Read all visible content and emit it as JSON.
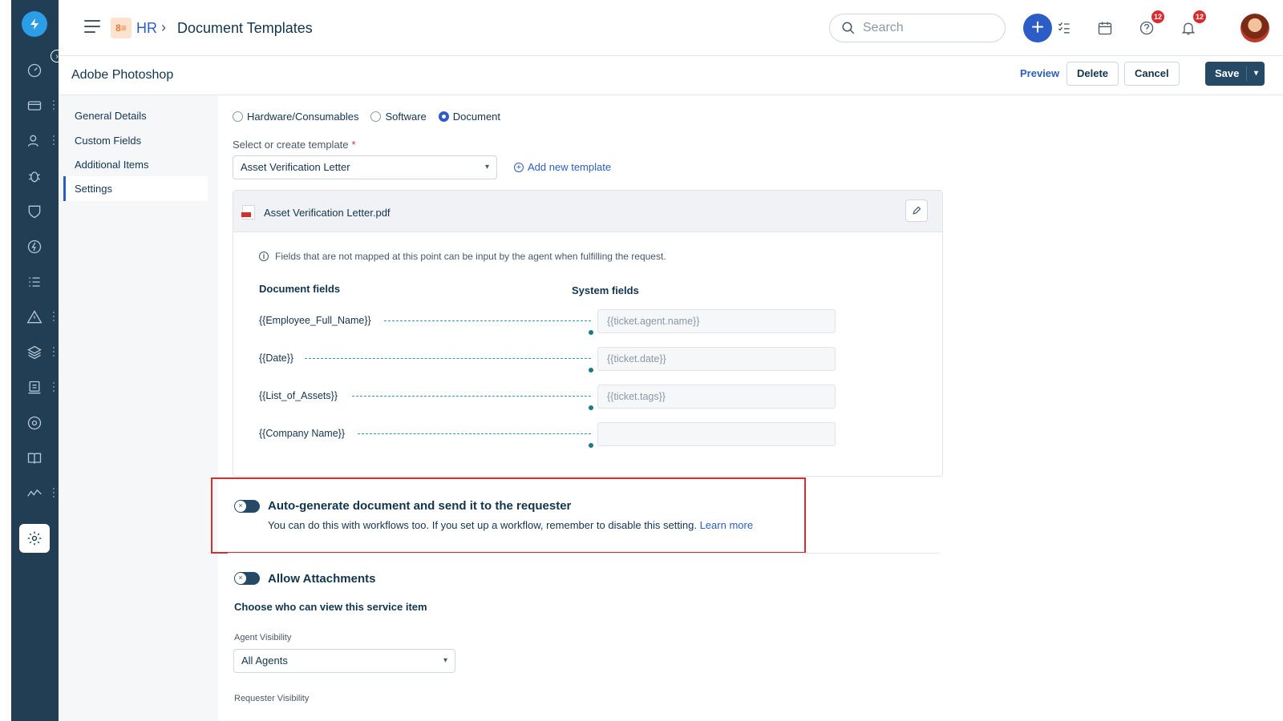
{
  "header": {
    "app_badge": "8≡",
    "breadcrumb_root": "HR",
    "breadcrumb_sep": "›",
    "page_title": "Document Templates",
    "search_placeholder": "Search",
    "help_badge": "12",
    "notifications_badge": "12"
  },
  "subheader": {
    "title": "Adobe Photoshop",
    "preview_label": "Preview",
    "delete_label": "Delete",
    "cancel_label": "Cancel",
    "save_label": "Save"
  },
  "settings_nav": [
    {
      "label": "General Details",
      "active": false
    },
    {
      "label": "Custom Fields",
      "active": false
    },
    {
      "label": "Additional Items",
      "active": false
    },
    {
      "label": "Settings",
      "active": true
    }
  ],
  "item_type": {
    "options": [
      {
        "label": "Hardware/Consumables",
        "selected": false
      },
      {
        "label": "Software",
        "selected": false
      },
      {
        "label": "Document",
        "selected": true
      }
    ]
  },
  "template": {
    "label": "Select or create template",
    "required_mark": "*",
    "selected": "Asset Verification Letter",
    "add_new_label": "Add new template"
  },
  "document": {
    "file_name": "Asset Verification Letter.pdf",
    "info_text": "Fields that are not mapped at this point can be input by the agent when fulfilling the request.",
    "document_fields_header": "Document fields",
    "system_fields_header": "System fields",
    "mappings": [
      {
        "document_field": "{{Employee_Full_Name}}",
        "system_field": "{{ticket.agent.name}}"
      },
      {
        "document_field": "{{Date}}",
        "system_field": "{{ticket.date}}"
      },
      {
        "document_field": "{{List_of_Assets}}",
        "system_field": "{{ticket.tags}}"
      },
      {
        "document_field": "{{Company Name}}",
        "system_field": ""
      }
    ]
  },
  "auto_generate": {
    "title": "Auto-generate document and send it to the requester",
    "description": "You can do this with workflows too. If you set up a workflow, remember to disable this setting.",
    "learn_more": "Learn more",
    "enabled": false
  },
  "attachments": {
    "title": "Allow Attachments",
    "enabled": false
  },
  "visibility": {
    "question": "Choose who can view this service item",
    "agent_label": "Agent Visibility",
    "agent_value": "All Agents",
    "requester_label": "Requester Visibility"
  },
  "colors": {
    "rail": "#213e55",
    "primary_blue": "#2c5cc5",
    "save_button": "#264966",
    "highlight_border": "#d72d30"
  }
}
